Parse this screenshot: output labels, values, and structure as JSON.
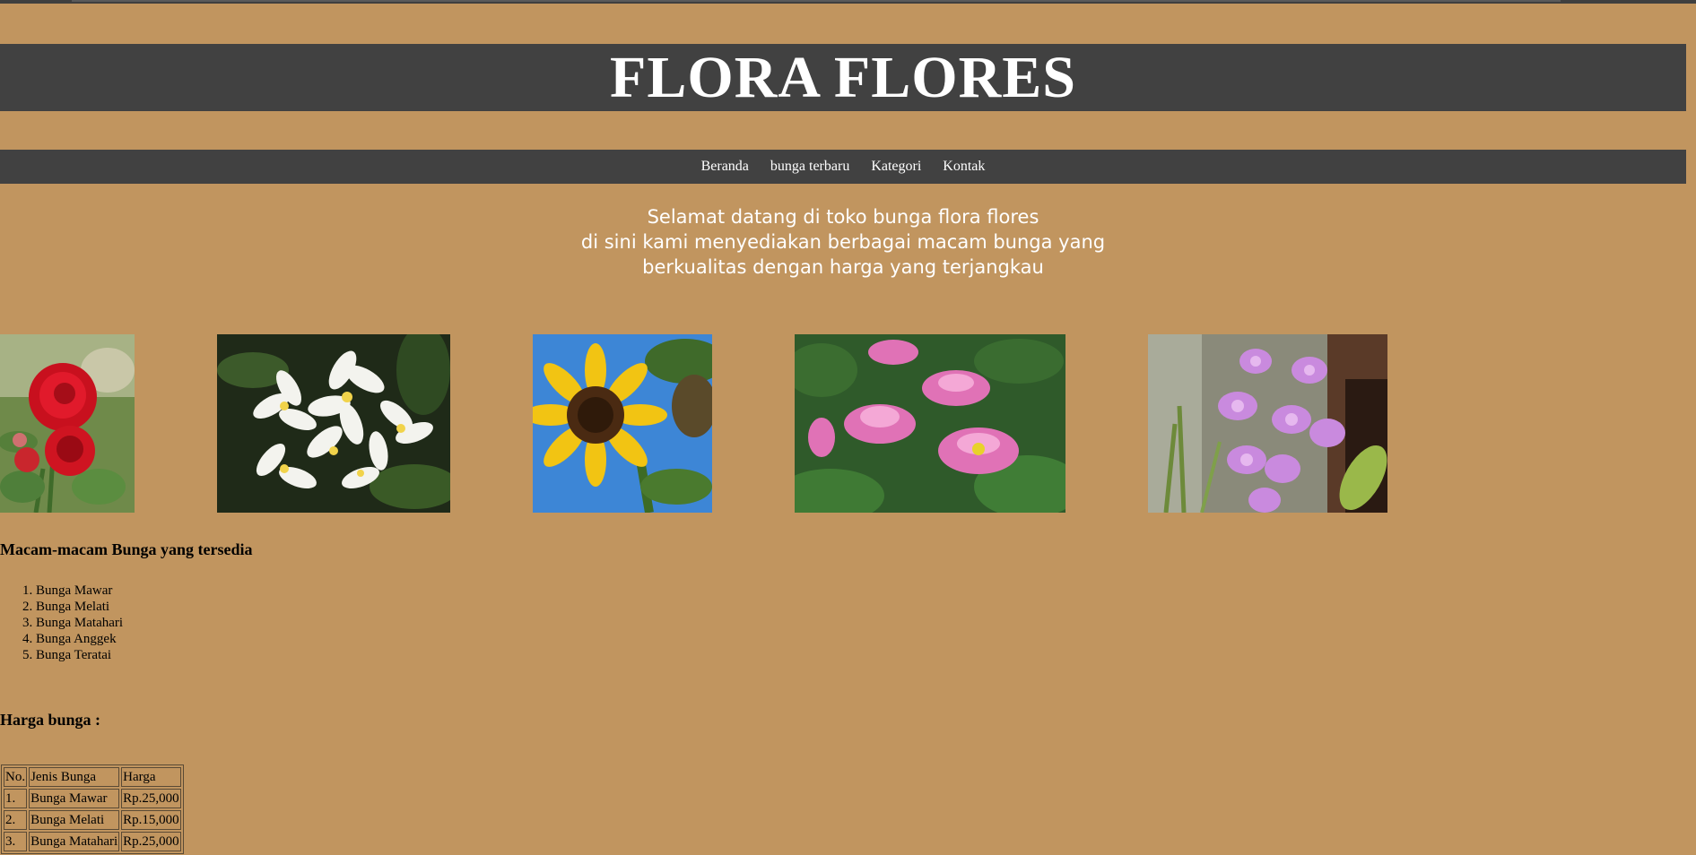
{
  "site": {
    "title": "FLORA FLORES"
  },
  "nav": {
    "items": [
      "Beranda",
      "bunga terbaru",
      "Kategori",
      "Kontak"
    ]
  },
  "welcome": {
    "lines": [
      "Selamat datang di toko bunga flora flores",
      "di sini kami menyediakan berbagai macam bunga yang",
      "berkualitas dengan harga yang terjangkau"
    ]
  },
  "gallery": {
    "images": [
      {
        "name": "rose-photo",
        "subject": "red roses"
      },
      {
        "name": "jasmine-photo",
        "subject": "white frangipani flowers"
      },
      {
        "name": "sunflower-photo",
        "subject": "sunflower"
      },
      {
        "name": "lotus-photo",
        "subject": "pink lotus flowers"
      },
      {
        "name": "orchid-photo",
        "subject": "purple orchids"
      }
    ]
  },
  "flower_list": {
    "heading": "Macam-macam Bunga yang tersedia",
    "items": [
      "Bunga Mawar",
      "Bunga Melati",
      "Bunga Matahari",
      "Bunga Anggek",
      "Bunga Teratai"
    ]
  },
  "prices": {
    "heading": "Harga bunga :",
    "columns": [
      "No.",
      "Jenis Bunga",
      "Harga"
    ],
    "rows": [
      [
        "1.",
        "Bunga Mawar",
        "Rp.25,000"
      ],
      [
        "2.",
        "Bunga Melati",
        "Rp.15,000"
      ],
      [
        "3.",
        "Bunga Matahari",
        "Rp.25,000"
      ]
    ]
  },
  "colors": {
    "page_bg": "#c1955f",
    "bar_bg": "#414141",
    "bar_text": "#ffffff"
  }
}
